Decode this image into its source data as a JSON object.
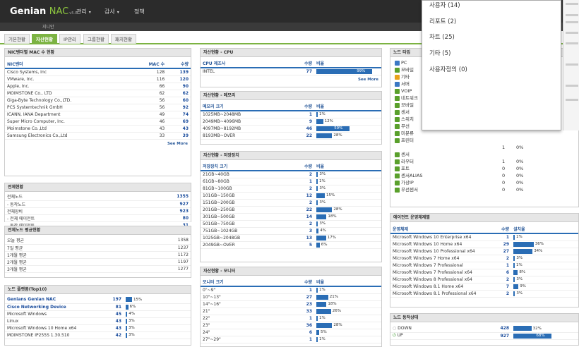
{
  "header": {
    "brand": "Genian",
    "brand_nac": "NAC",
    "version": "v5.0",
    "nav": [
      "관리",
      "감사",
      "정책"
    ],
    "sub": "지니안"
  },
  "tabs": [
    "기본현황",
    "자산현황",
    "IP관리",
    "그룹현황",
    "패치현황"
  ],
  "dropdown": {
    "items": [
      "사용자 (14)",
      "리포트 (2)",
      "차트 (25)",
      "기타 (5)",
      "사용자정의 (0)"
    ]
  },
  "nic": {
    "title": "NIC벤더별 MAC 수 현황",
    "cols": [
      "NIC벤더",
      "MAC 수",
      "수량"
    ],
    "rows": [
      [
        "Cisco Systems, Inc",
        "128",
        "139"
      ],
      [
        "VMware, Inc.",
        "116",
        "120"
      ],
      [
        "Apple, Inc.",
        "66",
        "90"
      ],
      [
        "MOIMSTONE Co., LTD",
        "62",
        "62"
      ],
      [
        "Giga-Byte Technology Co.,LTD.",
        "56",
        "60"
      ],
      [
        "PCS Systemtechnik GmbH",
        "56",
        "92"
      ],
      [
        "ICANN, IANA Department",
        "49",
        "74"
      ],
      [
        "Super Micro Computer, Inc.",
        "46",
        "69"
      ],
      [
        "Moimstone Co.,Ltd",
        "43",
        "43"
      ],
      [
        "Samsung Electronics Co.,Ltd",
        "33",
        "39"
      ]
    ],
    "more": "See More"
  },
  "overall": {
    "title": "전체현황",
    "rows": [
      [
        "전체노드",
        "1355"
      ],
      [
        "- 동작노드",
        "927"
      ],
      [
        "전체장비",
        "923"
      ],
      [
        "- 전체 에이전트",
        "80"
      ],
      [
        "- 동작 에이전트",
        "31"
      ]
    ]
  },
  "avgnodes": {
    "title": "전체노드 평균현황",
    "rows": [
      [
        "오늘 평균",
        "1358"
      ],
      [
        "7일 평균",
        "1237"
      ],
      [
        "1개월 평균",
        "1172"
      ],
      [
        "2개월 평균",
        "1197"
      ],
      [
        "3개월 평균",
        "1277"
      ]
    ]
  },
  "platform": {
    "title": "노드 플랫폼(Top10)",
    "rows": [
      [
        "Genians Genian NAC",
        "197",
        15,
        "15%"
      ],
      [
        "Cisco Networking Device",
        "81",
        6,
        "6%"
      ],
      [
        "Microsoft Windows",
        "45",
        4,
        "4%"
      ],
      [
        "Linux",
        "43",
        3,
        "3%"
      ],
      [
        "Microsoft Windows 10 Home x64",
        "43",
        3,
        "3%"
      ],
      [
        "MOIMSTONE IP255S 1.30.510",
        "42",
        3,
        "3%"
      ]
    ]
  },
  "cpu": {
    "title": "자산현황 - CPU",
    "cols": [
      "CPU 제조사",
      "수량",
      "비율"
    ],
    "rows": [
      [
        "INTEL",
        "77",
        99,
        "99%"
      ]
    ],
    "more": "See More"
  },
  "memory": {
    "title": "자산현황 - 메모리",
    "cols": [
      "메모리 크기",
      "수량",
      "비율"
    ],
    "rows": [
      [
        "1025MB~2048MB",
        "1",
        1,
        "1%"
      ],
      [
        "2049MB~4096MB",
        "9",
        12,
        "12%"
      ],
      [
        "4097MB~8192MB",
        "46",
        59,
        "59%"
      ],
      [
        "8193MB~OVER",
        "22",
        28,
        "28%"
      ]
    ]
  },
  "storage": {
    "title": "자산현황 - 저장장치",
    "cols": [
      "저장장치 크기",
      "수량",
      "비율"
    ],
    "rows": [
      [
        "21GB~40GB",
        "2",
        3,
        "3%"
      ],
      [
        "61GB~80GB",
        "1",
        1,
        "1%"
      ],
      [
        "81GB~100GB",
        "2",
        3,
        "3%"
      ],
      [
        "101GB~150GB",
        "12",
        15,
        "15%"
      ],
      [
        "151GB~200GB",
        "2",
        3,
        "3%"
      ],
      [
        "201GB~250GB",
        "22",
        28,
        "28%"
      ],
      [
        "301GB~500GB",
        "14",
        18,
        "18%"
      ],
      [
        "501GB~750GB",
        "2",
        3,
        "3%"
      ],
      [
        "751GB~1024GB",
        "3",
        4,
        "4%"
      ],
      [
        "1025GB~2048GB",
        "13",
        17,
        "17%"
      ],
      [
        "2049GB~OVER",
        "5",
        6,
        "6%"
      ]
    ]
  },
  "monitor": {
    "title": "자산현황 - 모니터",
    "cols": [
      "모니터 크기",
      "수량",
      "비율"
    ],
    "rows": [
      [
        "0\"~9\"",
        "1",
        1,
        "1%"
      ],
      [
        "10\"~13\"",
        "27",
        21,
        "21%"
      ],
      [
        "14\"~16\"",
        "23",
        18,
        "18%"
      ],
      [
        "21\"",
        "33",
        26,
        "26%"
      ],
      [
        "22\"",
        "1",
        1,
        "1%"
      ],
      [
        "23\"",
        "36",
        28,
        "28%"
      ],
      [
        "24\"",
        "6",
        5,
        "5%"
      ],
      [
        "27\"~29\"",
        "1",
        1,
        "1%"
      ]
    ]
  },
  "nodetype": {
    "title": "노드 타입",
    "rows": [
      [
        "PC",
        "#3b78c4"
      ],
      [
        "모바일",
        "#5aa02c"
      ],
      [
        "기타",
        "#e8a21a"
      ],
      [
        "서버",
        "#3b78c4"
      ],
      [
        "VOIP",
        "#5aa02c"
      ],
      [
        "네트워크",
        "#5aa02c"
      ],
      [
        "모바일",
        "#5aa02c"
      ],
      [
        "센서",
        "#5aa02c"
      ],
      [
        "스위치",
        "#5aa02c"
      ],
      [
        "무선",
        "#5aa02c"
      ],
      [
        "미분류",
        "#5aa02c"
      ],
      [
        "프린터",
        "#5aa02c"
      ],
      [
        "센서",
        "#5aa02c"
      ]
    ],
    "tail": [
      [
        "라우터",
        "1",
        "0%"
      ],
      [
        "포트",
        "0",
        "0%"
      ],
      [
        "센서ALIAS",
        "0",
        "0%"
      ],
      [
        "가상IP",
        "0",
        "0%"
      ],
      [
        "무선센서",
        "0",
        "0%"
      ]
    ],
    "tail_pre": [
      "1",
      "0%"
    ]
  },
  "agentos": {
    "title": "에이전트 운영체제별",
    "cols": [
      "운영체제",
      "수량",
      "설치율"
    ],
    "rows": [
      [
        "Microsoft Windows 10 Enterprise x64",
        "1",
        1,
        "1%"
      ],
      [
        "Microsoft Windows 10 Home x64",
        "29",
        36,
        "36%"
      ],
      [
        "Microsoft Windows 10 Professional x64",
        "27",
        34,
        "34%"
      ],
      [
        "Microsoft Windows 7 Home x64",
        "2",
        3,
        "3%"
      ],
      [
        "Microsoft Windows 7 Professional",
        "1",
        1,
        "1%"
      ],
      [
        "Microsoft Windows 7 Professional x64",
        "6",
        8,
        "8%"
      ],
      [
        "Microsoft Windows 8 Professional x64",
        "2",
        3,
        "3%"
      ],
      [
        "Microsoft Windows 8.1 Home x64",
        "7",
        9,
        "9%"
      ],
      [
        "Microsoft Windows 8.1 Professional x64",
        "2",
        3,
        "3%"
      ]
    ]
  },
  "nodestatus": {
    "title": "노드 동작상태",
    "rows": [
      [
        "DOWN",
        "428",
        32,
        "32%"
      ],
      [
        "UP",
        "927",
        68,
        "68%"
      ]
    ]
  },
  "colors": {
    "accent": "#7cb342",
    "bar": "#2a6db5",
    "header": "#2b2b2b"
  }
}
